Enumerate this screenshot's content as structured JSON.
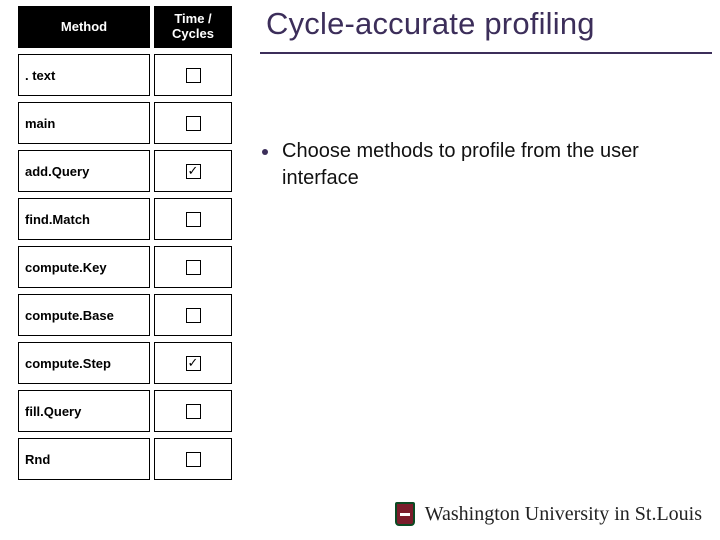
{
  "title": "Cycle-accurate profiling",
  "table": {
    "header_method": "Method",
    "header_tc": "Time / Cycles",
    "rows": [
      {
        "name": ". text",
        "checked": false
      },
      {
        "name": "main",
        "checked": false
      },
      {
        "name": "add.Query",
        "checked": true
      },
      {
        "name": "find.Match",
        "checked": false
      },
      {
        "name": "compute.Key",
        "checked": false
      },
      {
        "name": "compute.Base",
        "checked": false
      },
      {
        "name": "compute.Step",
        "checked": true
      },
      {
        "name": "fill.Query",
        "checked": false
      },
      {
        "name": "Rnd",
        "checked": false
      }
    ]
  },
  "bullet": "Choose methods to profile from the user interface",
  "footer": "Washington University in St.Louis",
  "colors": {
    "accent": "#3c2e5a",
    "shield_bg": "#7a1d2b",
    "shield_border": "#0b4a23"
  }
}
